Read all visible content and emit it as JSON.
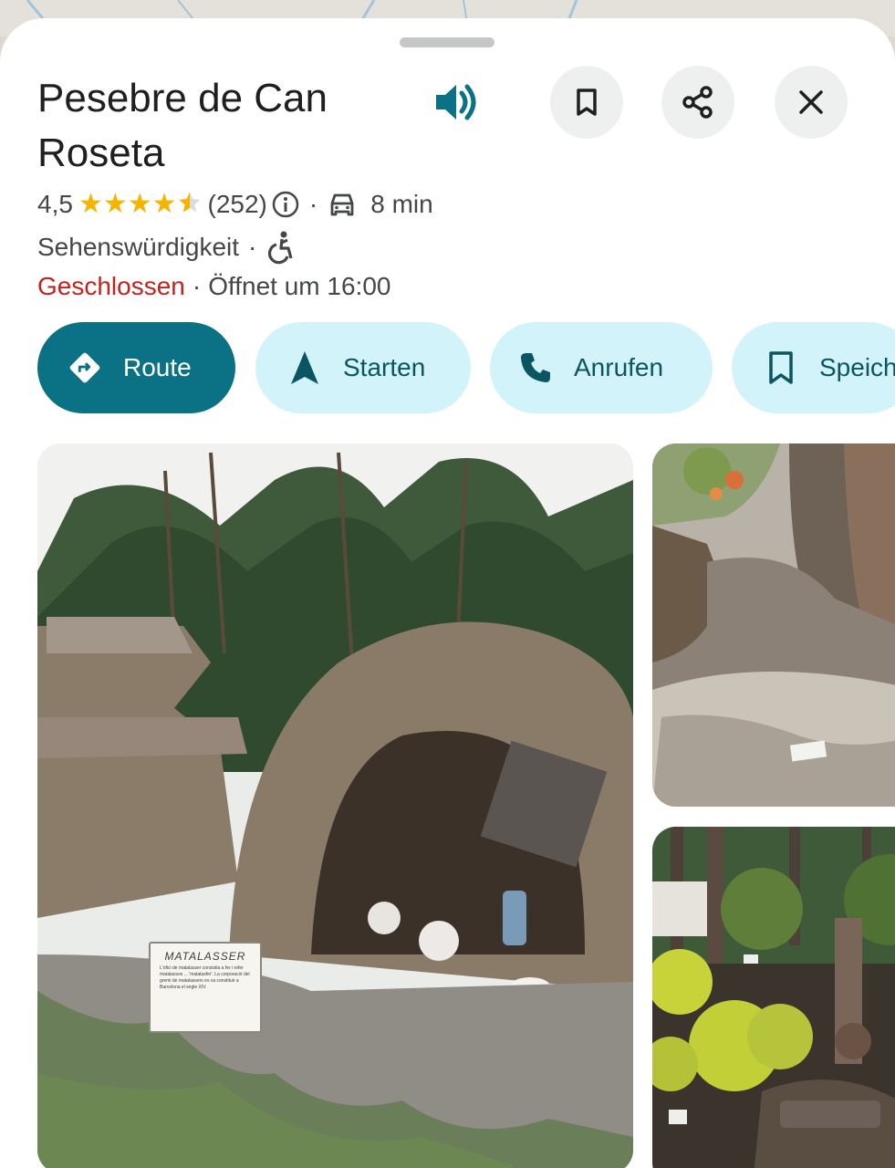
{
  "place": {
    "name": "Pesebre de Can Roseta",
    "rating": "4,5",
    "stars": "★★★★",
    "reviews": "(252)",
    "drive_time": "8 min",
    "category": "Sehenswürdigkeit",
    "status": "Geschlossen",
    "opens": "Öffnet um 16:00"
  },
  "separators": {
    "dot": "·"
  },
  "actions": [
    {
      "label": "Route",
      "icon": "directions-icon"
    },
    {
      "label": "Starten",
      "icon": "navigation-arrow-icon"
    },
    {
      "label": "Anrufen",
      "icon": "phone-icon"
    },
    {
      "label": "Speich",
      "icon": "bookmark-icon"
    }
  ],
  "photo_sign": {
    "heading": "MATALASSER",
    "body": "L'ofici de matalasser consistia a fer i refer matalassos ... 'matalasfer'. La corporació del gremi de matalassers es va constituir a Barcelona el segle XIV."
  },
  "colors": {
    "primary": "#0b7285",
    "pill_bg": "#d3f3fb",
    "closed": "#c5221f",
    "star": "#f4b400"
  }
}
